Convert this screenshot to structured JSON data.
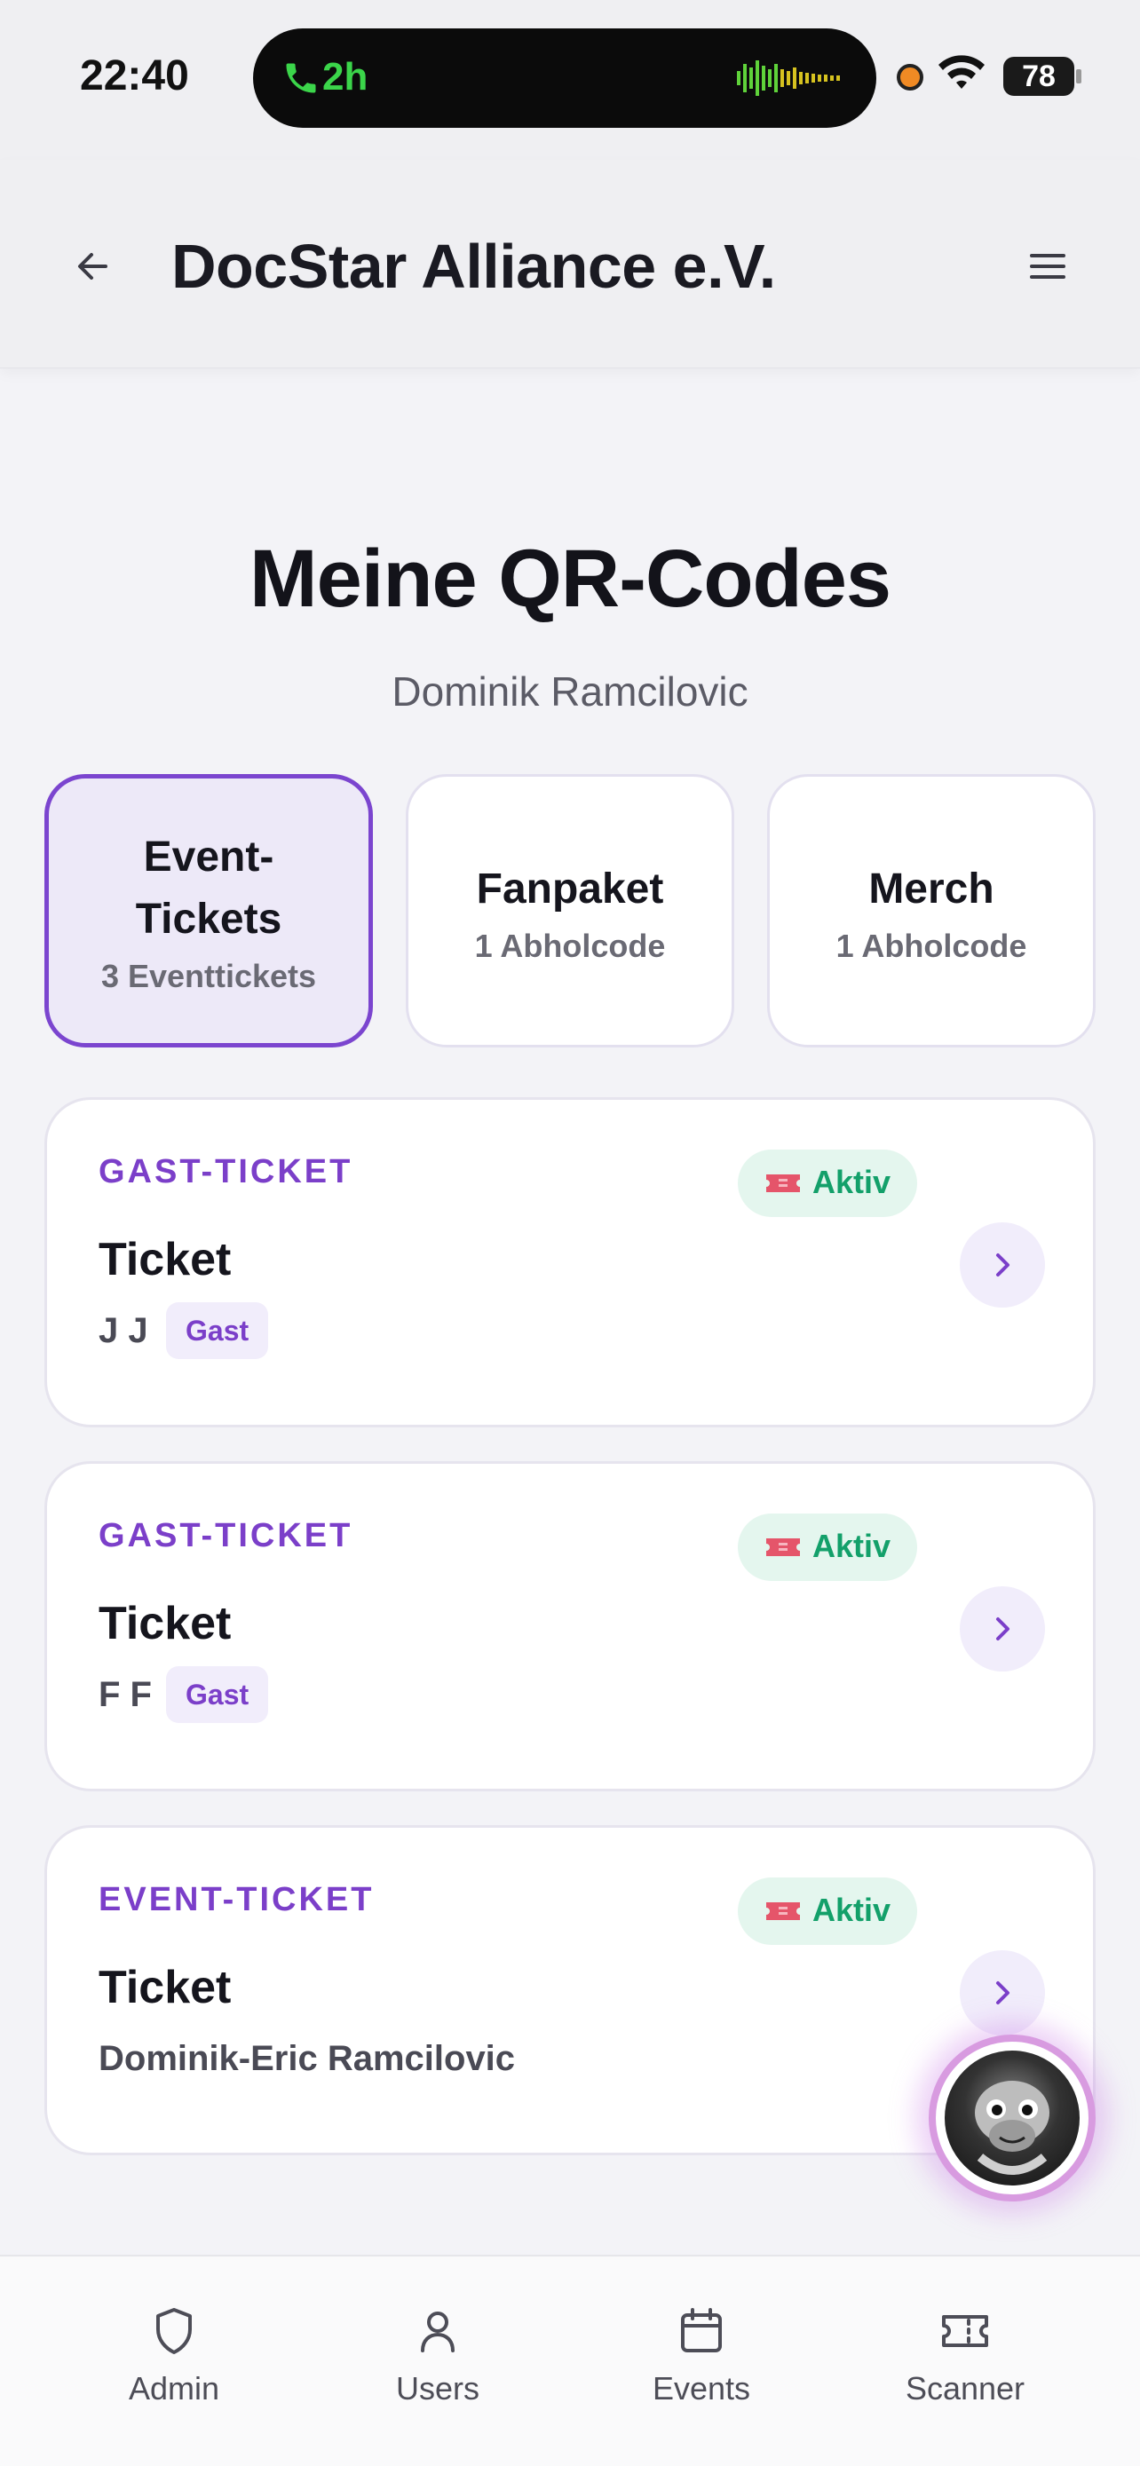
{
  "status_bar": {
    "time": "22:40",
    "call_duration": "2h",
    "battery": "78"
  },
  "header": {
    "title": "DocStar Alliance e.V."
  },
  "page": {
    "title": "Meine QR-Codes",
    "subtitle": "Dominik Ramcilovic"
  },
  "tabs": [
    {
      "title_line1": "Event-",
      "title_line2": "Tickets",
      "subtitle": "3 Eventtickets",
      "active": true
    },
    {
      "title": "Fanpaket",
      "subtitle": "1 Abholcode",
      "active": false
    },
    {
      "title": "Merch",
      "subtitle": "1 Abholcode",
      "active": false
    }
  ],
  "tickets": [
    {
      "type": "GAST-TICKET",
      "status": "Aktiv",
      "name": "Ticket",
      "holder": "J J",
      "tag": "Gast"
    },
    {
      "type": "GAST-TICKET",
      "status": "Aktiv",
      "name": "Ticket",
      "holder": "F F",
      "tag": "Gast"
    },
    {
      "type": "EVENT-TICKET",
      "status": "Aktiv",
      "name": "Ticket",
      "holder": "Dominik-Eric Ramcilovic",
      "tag": ""
    }
  ],
  "bottom_nav": [
    {
      "label": "Admin",
      "icon": "shield-icon"
    },
    {
      "label": "Users",
      "icon": "user-icon"
    },
    {
      "label": "Events",
      "icon": "calendar-icon"
    },
    {
      "label": "Scanner",
      "icon": "ticket-icon"
    }
  ],
  "colors": {
    "accent": "#7b3fc9",
    "active_green": "#13a06a"
  }
}
